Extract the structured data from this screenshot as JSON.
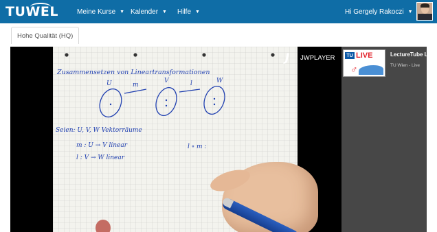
{
  "header": {
    "logo_text": "TUWEL",
    "nav": [
      {
        "label": "Meine Kurse"
      },
      {
        "label": "Kalender"
      },
      {
        "label": "Hilfe"
      }
    ],
    "user_greeting": "Hi Gergely Rakoczi"
  },
  "tabs": [
    {
      "label": "Hohe Qualität (HQ)",
      "active": true
    }
  ],
  "player": {
    "brand": "JWPLAYER",
    "video_handwriting": {
      "title": "Zusammensetzen von Lineartransformationen",
      "space_labels": [
        "U",
        "m",
        "V",
        "l",
        "W"
      ],
      "line1": "Seien: U, V, W Vektorräume",
      "line2": "m : U → V   linear",
      "line3": "l : V → W   linear",
      "line4": "l ∘ m :"
    }
  },
  "playlist": [
    {
      "title": "LectureTube Live",
      "subtitle": "TU Wien - Live",
      "thumb_logo": "TU",
      "thumb_text": "LIVE"
    }
  ],
  "colors": {
    "nav_bg": "#0f6da6",
    "stage_bg": "#474747",
    "live_red": "#e2232c",
    "tu_blue": "#0a58a6"
  }
}
